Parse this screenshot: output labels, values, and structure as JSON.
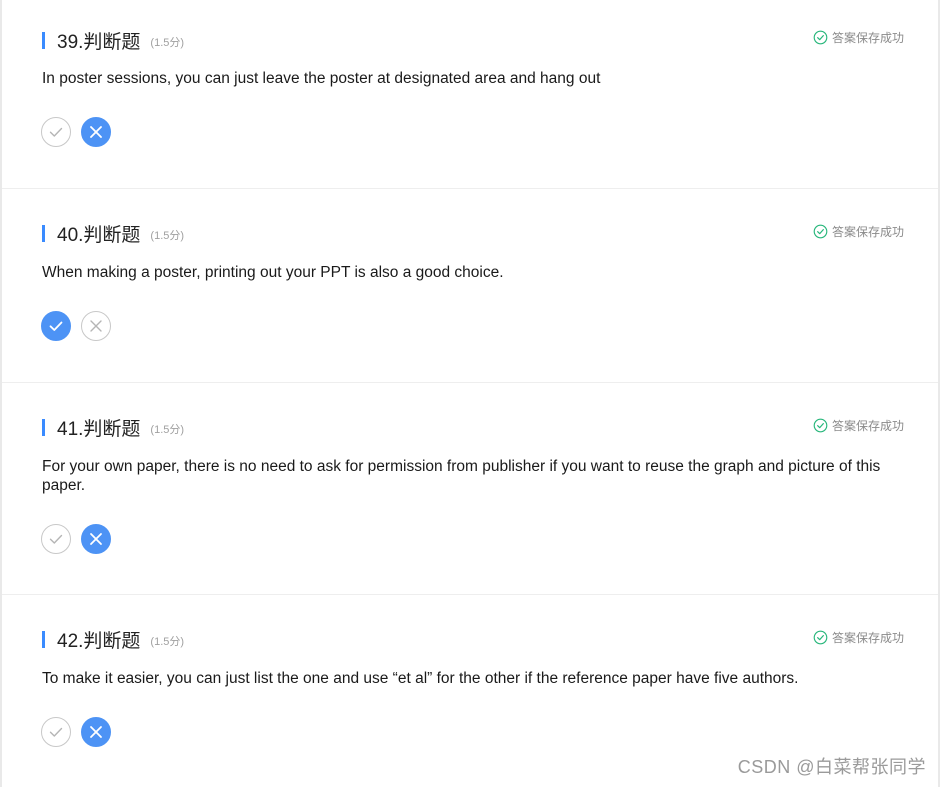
{
  "questions": [
    {
      "title": "39.判断题",
      "score": "(1.5分)",
      "status": "答案保存成功",
      "text": "In poster sessions, you can just leave the poster at designated area and hang out",
      "selected": "false"
    },
    {
      "title": "40.判断题",
      "score": "(1.5分)",
      "status": "答案保存成功",
      "text": "When making a poster, printing out your PPT is also a good choice.",
      "selected": "true"
    },
    {
      "title": "41.判断题",
      "score": "(1.5分)",
      "status": "答案保存成功",
      "text": "For your own paper, there is no need to ask for permission from publisher if you want to reuse the graph and picture of this paper.",
      "selected": "false"
    },
    {
      "title": "42.判断题",
      "score": "(1.5分)",
      "status": "答案保存成功",
      "text": "To make it easier, you can just list the one and use “et al” for the other if the reference paper have five authors.",
      "selected": "false"
    }
  ],
  "icons": {
    "true_option": "check-icon",
    "false_option": "x-icon",
    "status": "check-circle-icon"
  },
  "colors": {
    "accent": "#3a8bff",
    "selected": "#4d93f5",
    "status_green": "#26b67a"
  },
  "watermark": "CSDN @白菜帮张同学"
}
